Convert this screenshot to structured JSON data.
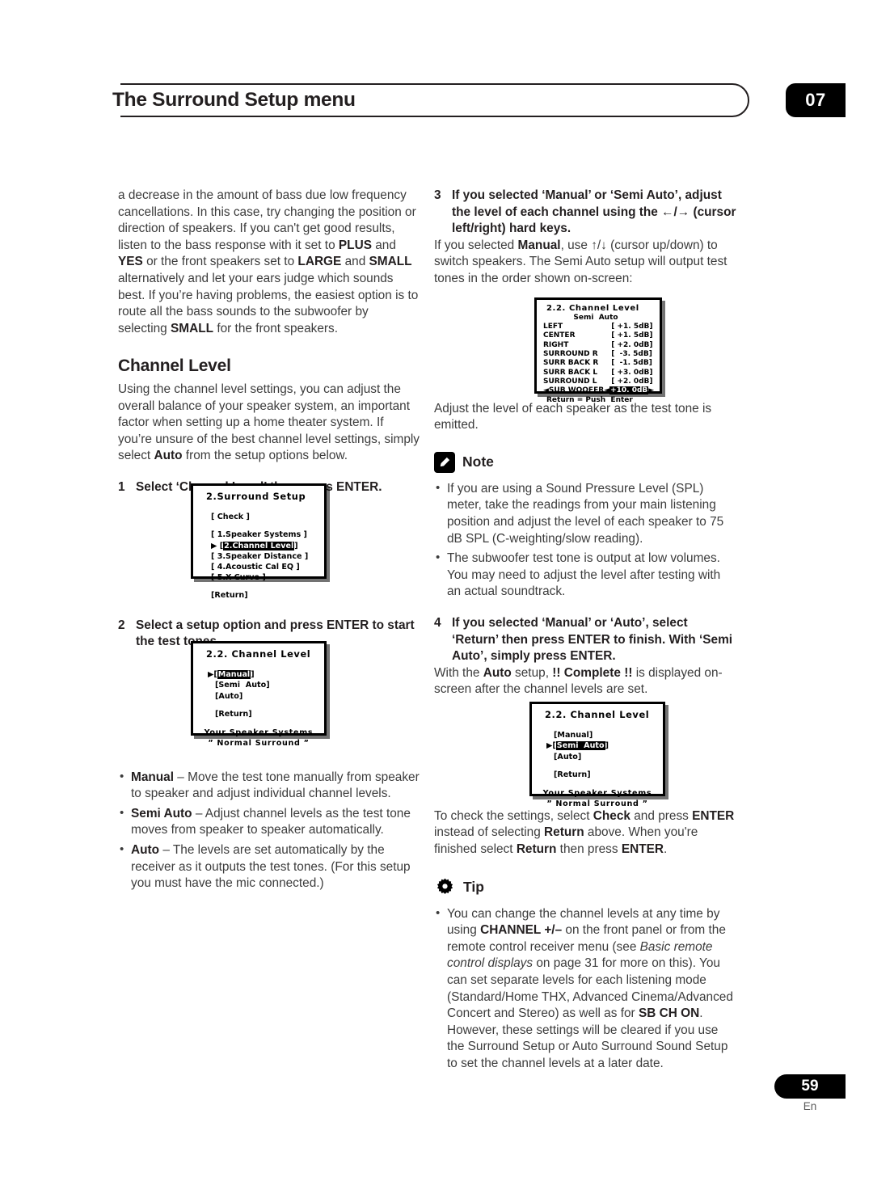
{
  "header": {
    "title": "The Surround Setup menu",
    "chapter": "07"
  },
  "footer": {
    "page_number": "59",
    "language": "En"
  },
  "left_column": {
    "intro_paragraph_html": "a decrease in the amount of bass due low frequency cancellations. In this case, try changing the position or direction of speakers. If you can't get good results, listen to the bass response with it set to <b>PLUS</b> and <b>YES</b> or the front speakers set to <b>LARGE</b> and <b>SMALL</b> alternatively and let your ears judge which sounds best. If you’re having problems, the easiest option is to route all the bass sounds to the subwoofer by selecting <b>SMALL</b> for the front speakers.",
    "section_title": "Channel Level",
    "section_paragraph_html": "Using the channel level settings, you can adjust the overall balance of your speaker system, an important factor when setting up a home theater system. If you’re unsure of the best channel level settings, simply select <b>Auto</b> from the setup options below.",
    "step1_num": "1",
    "step1_text": "Select ‘Channel Level’ then press ENTER.",
    "step2_num": "2",
    "step2_text": "Select a setup option and press ENTER to start the test tones.",
    "bullets_html": [
      "<b>Manual</b> – Move the test tone manually from speaker to speaker and adjust individual channel levels.",
      "<b>Semi Auto</b> – Adjust channel levels as the test tone moves from speaker to speaker automatically.",
      "<b>Auto</b> – The levels are set automatically by the receiver as it outputs the test tones. (For this setup you must have the mic connected.)"
    ]
  },
  "right_column": {
    "step3_num": "3",
    "step3_text_html": "If you selected ‘Manual’ or ‘Semi Auto’, adjust the level of each channel using the ←/→ (cursor left/right) hard keys.",
    "step3_body_html": "If you selected <b>Manual</b>, use ↑/↓ (cursor up/down) to switch speakers. The Semi Auto setup will output test tones in the order shown on-screen:",
    "after_osd_paragraph": "Adjust the level of each speaker as the test tone is emitted.",
    "note_label": "Note",
    "note_bullets_html": [
      "If you are using a Sound Pressure Level (SPL) meter, take the readings from your main listening position and adjust the level of each speaker to 75 dB SPL (C-weighting/slow reading).",
      "The subwoofer test tone is output at low volumes. You may need to adjust the level after testing with an actual soundtrack."
    ],
    "step4_num": "4",
    "step4_text": "If you selected ‘Manual’ or ‘Auto’, select ‘Return’ then press ENTER to finish. With ‘Semi Auto’, simply press ENTER.",
    "step4_body_html": "With the <b>Auto</b> setup, <b>!! Complete !!</b> is displayed on-screen after the channel levels are set.",
    "check_paragraph_html": "To check the settings, select <b>Check</b> and press <b>ENTER</b> instead of selecting <b>Return</b> above. When you're finished select <b>Return</b> then press <b>ENTER</b>.",
    "tip_label": "Tip",
    "tip_bullets_html": [
      "You can change the channel levels at any time by using <b>CHANNEL  +/–</b> on the front panel or from the remote control receiver menu (see <i>Basic remote control displays</i> on page 31 for more on this). You can set separate levels for each listening mode (Standard/Home THX, Advanced Cinema/Advanced Concert and Stereo) as well as for <b>SB CH ON</b>. However, these settings will be cleared if you use the Surround Setup or Auto Surround Sound Setup to set the channel levels at a later date."
    ]
  },
  "osd_surround_setup": {
    "title": "2.Surround Setup",
    "check_item": "[ Check ]",
    "items": [
      {
        "label": "[ 1.Speaker Systems ]",
        "selected": false
      },
      {
        "label": "2.Channel Level",
        "selected": true,
        "prefix": "[",
        "suffix": "]"
      },
      {
        "label": "[ 3.Speaker Distance ]",
        "selected": false
      },
      {
        "label": "[ 4.Acoustic Cal EQ ]",
        "selected": false
      },
      {
        "label": "[ 5.X-Curve ]",
        "selected": false
      }
    ],
    "return_item": "[Return]"
  },
  "osd_channel_level_modes": {
    "title": "2.2. Channel  Level",
    "items": [
      {
        "label": "Manual",
        "selected": true
      },
      {
        "label": "Semi  Auto",
        "selected": false
      },
      {
        "label": "Auto",
        "selected": false
      }
    ],
    "return_item": "[Return]",
    "footer_line1": "Your  Speaker  Systems",
    "footer_line2": "” Normal  Surround ”"
  },
  "osd_semi_auto_levels": {
    "title": "2.2. Channel  Level",
    "mode_label": "Semi  Auto",
    "channels": [
      {
        "name": "LEFT",
        "value": "[ +1. 5dB]"
      },
      {
        "name": "CENTER",
        "value": "[ +1. 5dB]"
      },
      {
        "name": "RIGHT",
        "value": "[ +2. 0dB]"
      },
      {
        "name": "SURROUND R",
        "value": "[  -3. 5dB]"
      },
      {
        "name": "SURR BACK R",
        "value": "[  -1. 5dB]"
      },
      {
        "name": "SURR BACK L",
        "value": "[ +3. 0dB]"
      },
      {
        "name": "SURROUND L",
        "value": "[ +2. 0dB]"
      }
    ],
    "subwoofer_name": "SUB WOOFER",
    "subwoofer_value": "+10. 0dB",
    "left_arrow": "◄",
    "right_arrow": "►",
    "return_line": "Return = Push  Enter"
  },
  "osd_channel_level_semi": {
    "title": "2.2. Channel  Level",
    "items": [
      {
        "label": "Manual",
        "selected": false
      },
      {
        "label": "Semi  Auto",
        "selected": true
      },
      {
        "label": "Auto",
        "selected": false
      }
    ],
    "return_item": "[Return]",
    "footer_line1": "Your  Speaker  Systems",
    "footer_line2": "” Normal  Surround ”"
  }
}
